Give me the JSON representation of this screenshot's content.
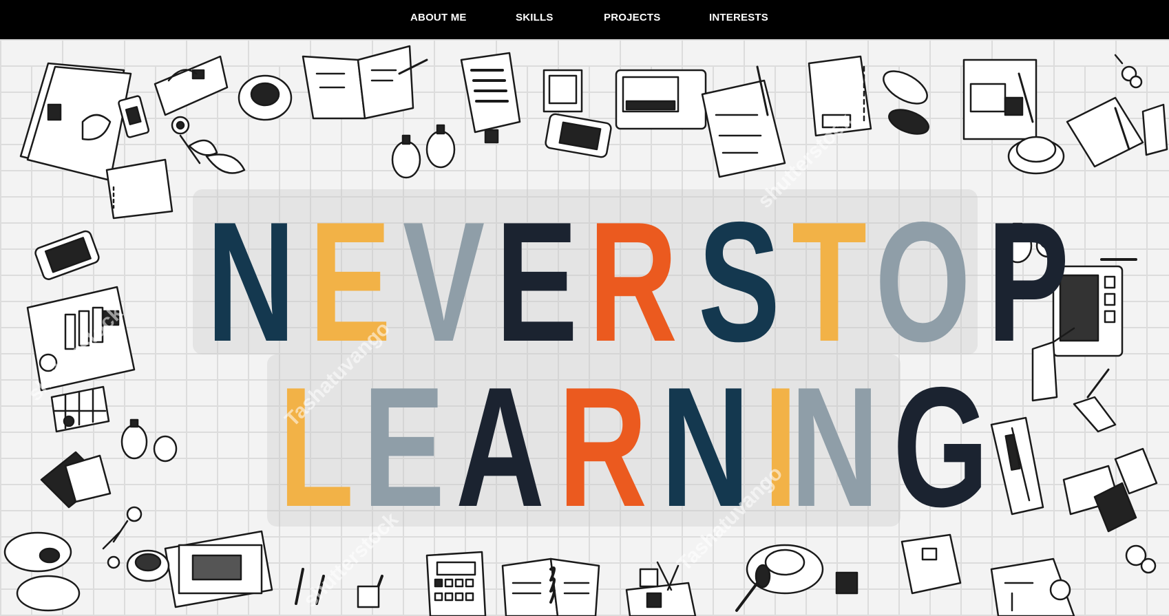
{
  "nav": {
    "items": [
      {
        "label": "ABOUT ME"
      },
      {
        "label": "SKILLS"
      },
      {
        "label": "PROJECTS"
      },
      {
        "label": "INTERESTS"
      }
    ]
  },
  "hero": {
    "line1": [
      {
        "char": "N",
        "color": "#14384f"
      },
      {
        "char": "E",
        "color": "#f2b247"
      },
      {
        "char": "V",
        "color": "#8f9ea8"
      },
      {
        "char": "E",
        "color": "#1b2330"
      },
      {
        "char": "R",
        "color": "#eb5a1f"
      },
      {
        "char": " ",
        "color": "#000000"
      },
      {
        "char": "S",
        "color": "#14384f"
      },
      {
        "char": "T",
        "color": "#f2b247"
      },
      {
        "char": "O",
        "color": "#8f9ea8"
      },
      {
        "char": "P",
        "color": "#1b2330"
      }
    ],
    "line2": [
      {
        "char": "L",
        "color": "#f2b247"
      },
      {
        "char": "E",
        "color": "#8f9ea8"
      },
      {
        "char": "A",
        "color": "#1b2330"
      },
      {
        "char": "R",
        "color": "#eb5a1f"
      },
      {
        "char": "N",
        "color": "#14384f"
      },
      {
        "char": "I",
        "color": "#f2b247"
      },
      {
        "char": "N",
        "color": "#8f9ea8"
      },
      {
        "char": "G",
        "color": "#1b2330"
      }
    ],
    "watermarks": [
      "Tashatuvango",
      "shutterstock",
      "Tashatuvango",
      "shutterstock",
      "shutterstock"
    ]
  },
  "icons": [
    "folder-icon",
    "handbag-icon",
    "coffee-cup-icon",
    "notebook-icon",
    "documents-icon",
    "tablet-icon",
    "clipboard-icon",
    "binder-icon",
    "glasses-icon",
    "notepad-icon",
    "phone-icon",
    "plant-icon",
    "calculator-icon",
    "laptop-icon",
    "keys-icon",
    "pens-icon",
    "wallet-icon",
    "envelope-icon",
    "calendar-icon",
    "bottles-icon"
  ]
}
